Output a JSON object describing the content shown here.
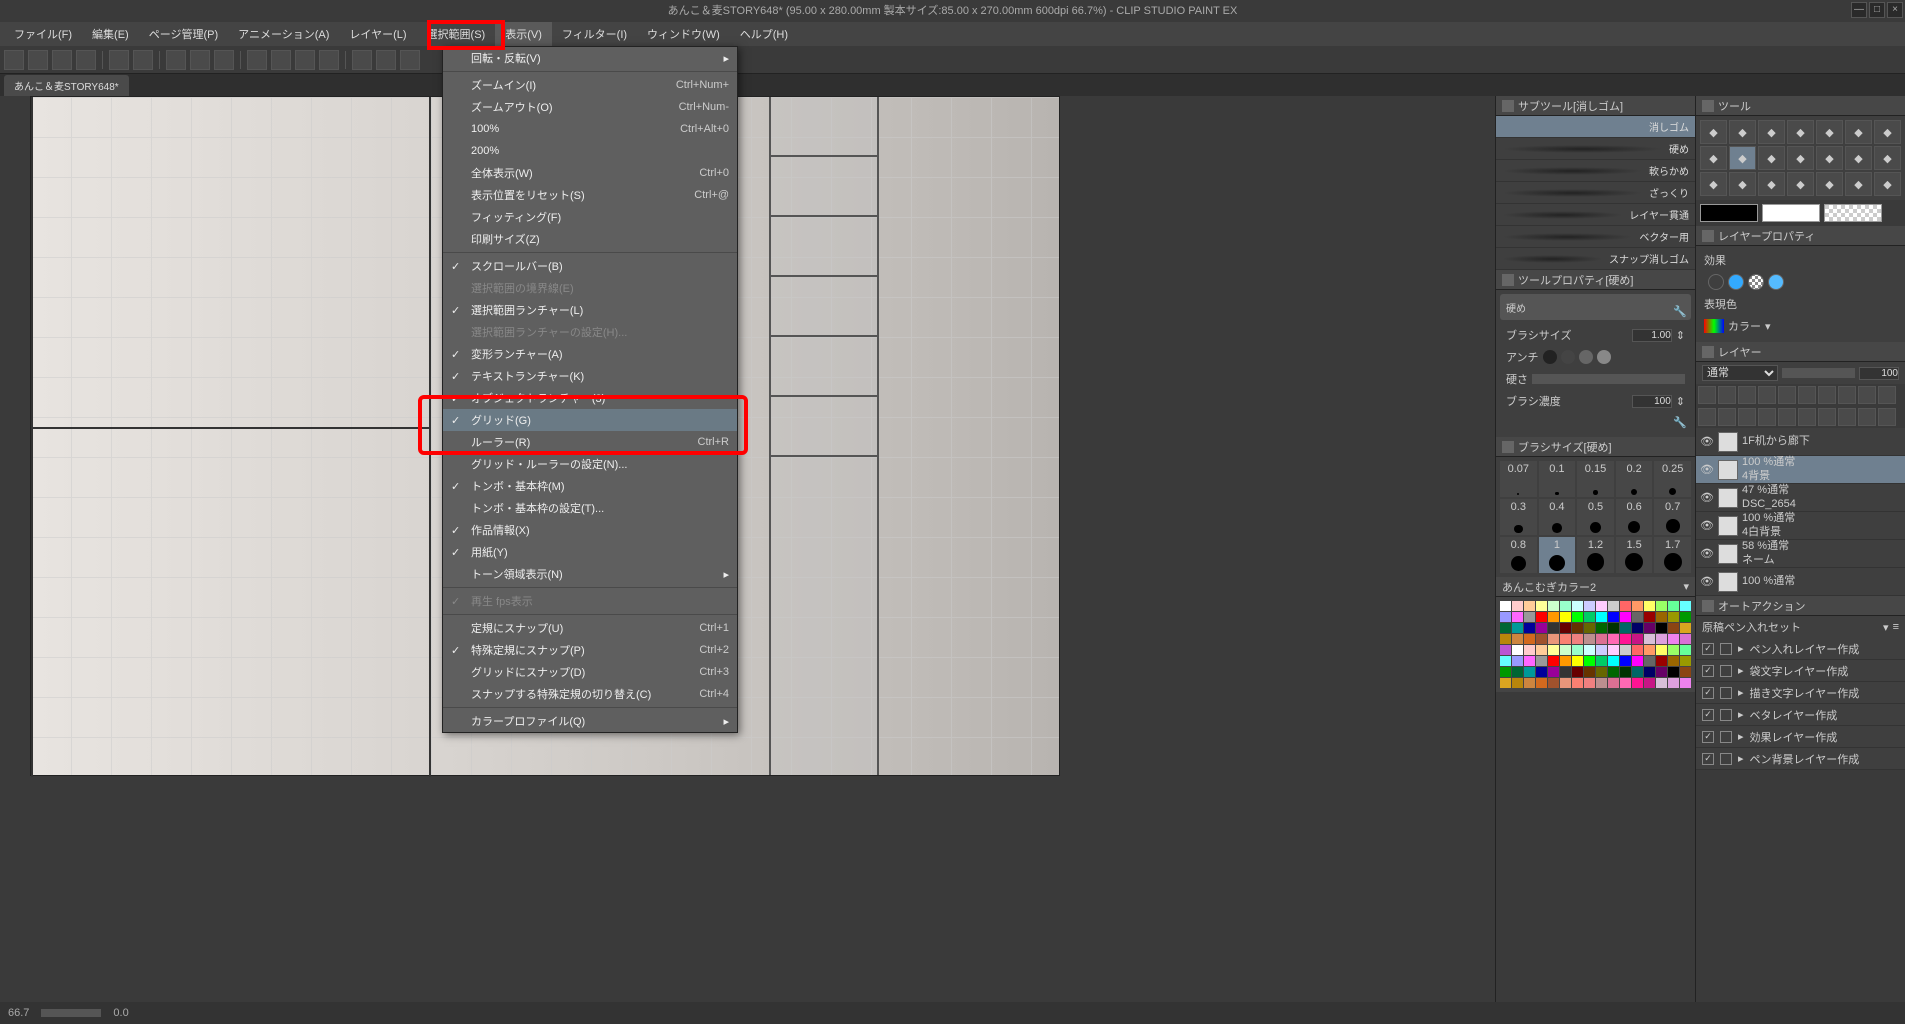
{
  "title": "あんこ＆麦STORY648* (95.00 x 280.00mm 製本サイズ:85.00 x 270.00mm 600dpi 66.7%)  - CLIP STUDIO PAINT EX",
  "menubar": [
    "ファイル(F)",
    "編集(E)",
    "ページ管理(P)",
    "アニメーション(A)",
    "レイヤー(L)",
    "選択範囲(S)",
    "表示(V)",
    "フィルター(I)",
    "ウィンドウ(W)",
    "ヘルプ(H)"
  ],
  "active_menu_index": 6,
  "tab": "あんこ＆麦STORY648*",
  "dropdown": [
    {
      "label": "回転・反転(V)",
      "arrow": true
    },
    {
      "sep": true
    },
    {
      "label": "ズームイン(I)",
      "shortcut": "Ctrl+Num+"
    },
    {
      "label": "ズームアウト(O)",
      "shortcut": "Ctrl+Num-"
    },
    {
      "label": "100%",
      "shortcut": "Ctrl+Alt+0"
    },
    {
      "label": "200%"
    },
    {
      "label": "全体表示(W)",
      "shortcut": "Ctrl+0"
    },
    {
      "label": "表示位置をリセット(S)",
      "shortcut": "Ctrl+@"
    },
    {
      "label": "フィッティング(F)"
    },
    {
      "label": "印刷サイズ(Z)"
    },
    {
      "sep": true
    },
    {
      "label": "スクロールバー(B)",
      "check": true
    },
    {
      "label": "選択範囲の境界線(E)",
      "disabled": true
    },
    {
      "label": "選択範囲ランチャー(L)",
      "check": true
    },
    {
      "label": "選択範囲ランチャーの設定(H)...",
      "disabled": true
    },
    {
      "label": "変形ランチャー(A)",
      "check": true
    },
    {
      "label": "テキストランチャー(K)",
      "check": true
    },
    {
      "label": "オブジェクトランチャー(3)",
      "check": true
    },
    {
      "label": "グリッド(G)",
      "check": true,
      "highlight": true
    },
    {
      "label": "ルーラー(R)",
      "shortcut": "Ctrl+R"
    },
    {
      "label": "グリッド・ルーラーの設定(N)..."
    },
    {
      "label": "トンボ・基本枠(M)",
      "check": true
    },
    {
      "label": "トンボ・基本枠の設定(T)..."
    },
    {
      "label": "作品情報(X)",
      "check": true
    },
    {
      "label": "用紙(Y)",
      "check": true
    },
    {
      "label": "トーン領域表示(N)",
      "arrow": true
    },
    {
      "sep": true
    },
    {
      "label": "再生 fps表示",
      "disabled": true,
      "check": true
    },
    {
      "sep": true
    },
    {
      "label": "定規にスナップ(U)",
      "shortcut": "Ctrl+1"
    },
    {
      "label": "特殊定規にスナップ(P)",
      "check": true,
      "shortcut": "Ctrl+2"
    },
    {
      "label": "グリッドにスナップ(D)",
      "shortcut": "Ctrl+3"
    },
    {
      "label": "スナップする特殊定規の切り替え(C)",
      "shortcut": "Ctrl+4"
    },
    {
      "sep": true
    },
    {
      "label": "カラープロファイル(Q)",
      "arrow": true
    }
  ],
  "subtool_panel": {
    "title": "サブツール[消しゴム]",
    "active": "消しゴム",
    "items": [
      "硬め",
      "軟らかめ",
      "ざっくり",
      "レイヤー貫通",
      "ベクター用",
      "スナップ消しゴム"
    ]
  },
  "tool_property": {
    "title": "ツールプロパティ[硬め]",
    "label": "硬め",
    "brush_size_label": "ブラシサイズ",
    "brush_size": "1.00",
    "anti_label": "アンチ",
    "hardness_label": "硬さ",
    "opacity_label": "ブラシ濃度",
    "opacity": "100"
  },
  "brush_size_panel": {
    "title": "ブラシサイズ[硬め]",
    "sizes": [
      "0.07",
      "0.1",
      "0.15",
      "0.2",
      "0.25",
      "0.3",
      "0.4",
      "0.5",
      "0.6",
      "0.7",
      "0.8",
      "1",
      "1.2",
      "1.5",
      "1.7"
    ],
    "active_index": 11
  },
  "color_set": {
    "title": "あんこむぎカラー2"
  },
  "tool_panel": {
    "title": "ツール"
  },
  "layer_property": {
    "title": "レイヤープロパティ",
    "effect": "効果",
    "render": "表現色",
    "color_label": "カラー"
  },
  "layer_panel": {
    "title": "レイヤー",
    "blend": "通常",
    "opacity": "100",
    "layers": [
      {
        "name": "1F机から廊下",
        "pct": "",
        "folder": true
      },
      {
        "name": "4背景",
        "pct": "100 %通常",
        "active": true
      },
      {
        "name": "DSC_2654",
        "pct": "47 %通常"
      },
      {
        "name": "4白背景",
        "pct": "100 %通常"
      },
      {
        "name": "ネーム",
        "pct": "58 %通常"
      },
      {
        "name": "",
        "pct": "100 %通常"
      }
    ]
  },
  "autoaction": {
    "title": "オートアクション",
    "set": "原稿ペン入れセット",
    "items": [
      "ペン入れレイヤー作成",
      "袋文字レイヤー作成",
      "描き文字レイヤー作成",
      "ベタレイヤー作成",
      "効果レイヤー作成",
      "ペン背景レイヤー作成"
    ]
  },
  "status": {
    "zoom": "66.7",
    "angle": "0.0"
  }
}
